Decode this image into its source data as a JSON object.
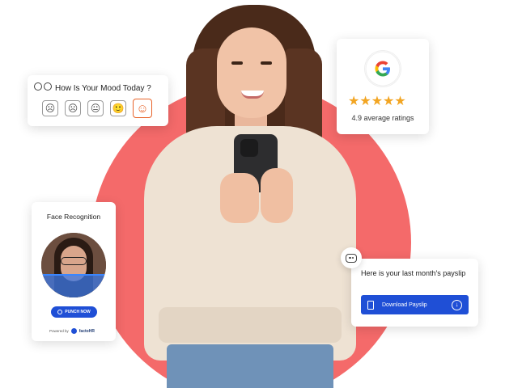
{
  "mood_card": {
    "title": "How Is Your Mood Today ?",
    "faces": [
      "☹",
      "☹",
      "😐",
      "🙂",
      "☺"
    ],
    "selected_index": 4,
    "accent": "#e8642a"
  },
  "rating_card": {
    "stars": "★★★★★",
    "text": "4.9 average ratings",
    "star_color": "#f2a522"
  },
  "face_card": {
    "title": "Face Recognition",
    "button_label": "PUNCH NOW",
    "powered_by": "Powered by",
    "brand": "factoHR"
  },
  "payslip_card": {
    "message": "Here is your last month's payslip",
    "button_label": "Download Payslip",
    "button_color": "#1f4fd6"
  },
  "theme": {
    "circle_color": "#f46a6a"
  }
}
